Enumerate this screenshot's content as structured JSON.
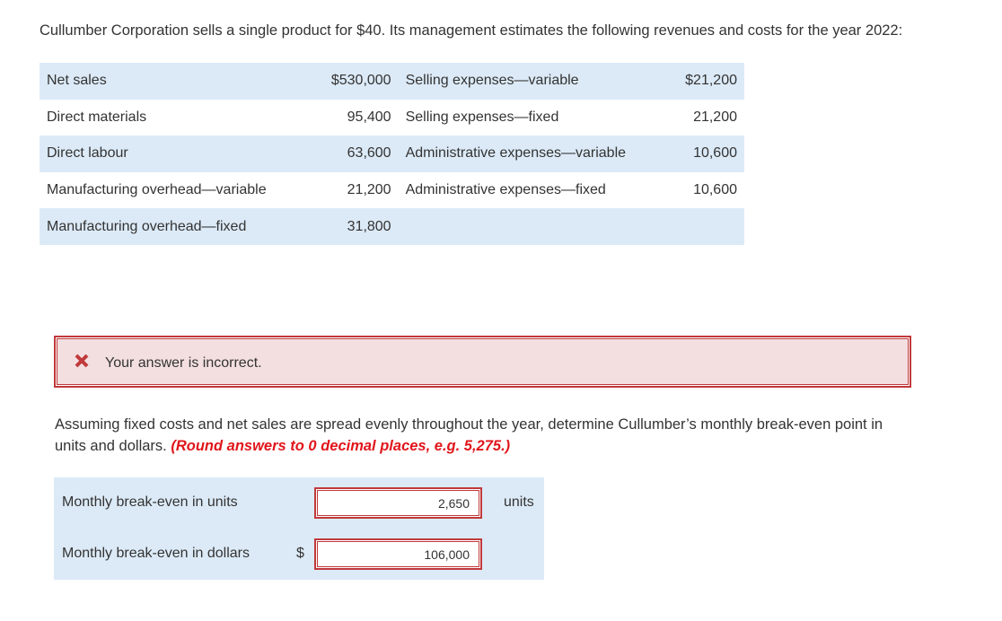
{
  "intro": "Cullumber Corporation sells a single product for $40. Its management estimates the following revenues and costs for the year 2022:",
  "costs": {
    "rows": [
      {
        "left_label": "Net sales",
        "left_value": "$530,000",
        "right_label": "Selling expenses—variable",
        "right_value": "$21,200"
      },
      {
        "left_label": "Direct materials",
        "left_value": "95,400",
        "right_label": "Selling expenses—fixed",
        "right_value": "21,200"
      },
      {
        "left_label": "Direct labour",
        "left_value": "63,600",
        "right_label": "Administrative expenses—variable",
        "right_value": "10,600"
      },
      {
        "left_label": "Manufacturing overhead—variable",
        "left_value": "21,200",
        "right_label": "Administrative expenses—fixed",
        "right_value": "10,600"
      },
      {
        "left_label": "Manufacturing overhead—fixed",
        "left_value": "31,800",
        "right_label": "",
        "right_value": ""
      }
    ]
  },
  "feedback": {
    "icon": "x-icon",
    "message": "Your answer is incorrect.",
    "color": "#c0393b"
  },
  "question": {
    "text": "Assuming fixed costs and net sales are spread evenly throughout the year, determine Cullumber’s monthly break-even point in units and dollars.",
    "hint": "(Round answers to 0 decimal places, e.g. 5,275.)"
  },
  "answers": {
    "units": {
      "label": "Monthly break-even in units",
      "value": "2,650",
      "unit": "units"
    },
    "dollars": {
      "label": "Monthly break-even in dollars",
      "prefix": "$",
      "value": "106,000"
    }
  }
}
